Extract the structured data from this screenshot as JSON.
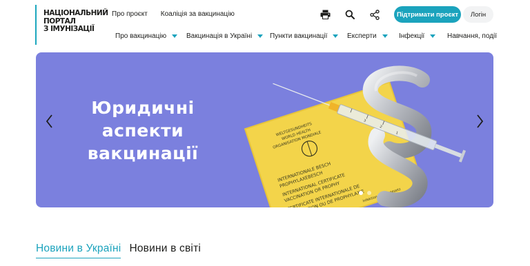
{
  "logo": {
    "line1": "Національний",
    "line2": "портал",
    "line3": "з імунізації"
  },
  "top_links": [
    "Про проєкт",
    "Коаліція за вакцинацію"
  ],
  "header_icons": [
    "printer-icon",
    "search-icon",
    "share-icon"
  ],
  "buttons": {
    "support": "Підтримати проєкт",
    "login": "Логін"
  },
  "nav": [
    {
      "label": "Про вакцинацію",
      "dropdown": true
    },
    {
      "label": "Вакцинація в Україні",
      "dropdown": true
    },
    {
      "label": "Пункти вакцинації",
      "dropdown": true
    },
    {
      "label": "Експерти",
      "dropdown": true
    },
    {
      "label": "Інфекції",
      "dropdown": true
    },
    {
      "label": "Навчання, події",
      "dropdown": false
    }
  ],
  "banner": {
    "title_line1": "Юридичні",
    "title_line2": "аспекти",
    "title_line3": "вакцинації",
    "background": "#7b80de",
    "slides": 2,
    "active_slide": 1,
    "certificate_text": {
      "top": [
        "WELTGESUNDHEITS",
        "WORLD HEALTH",
        "ORGANISATION MONDIALE"
      ],
      "bottom": [
        "INTERNATIONALE BESCH",
        "PROPHYLAXEBESCH",
        "INTERNATIONAL CERTIFICATE",
        "VACCINATION OR PROPHY",
        "CERTIFICATE INTERNATIONALE DE",
        "VACCINATION OU DE PROPHYLAXIE",
        "Infektionsschutzgesetz"
      ]
    },
    "syringe_marks": [
      "3",
      "2",
      "1"
    ]
  },
  "news_tabs": [
    {
      "label": "Новини в Україні",
      "active": true
    },
    {
      "label": "Новини в світі",
      "active": false
    }
  ],
  "colors": {
    "accent": "#1ba3bd",
    "banner": "#7b80de",
    "certificate": "#f3d44a"
  }
}
